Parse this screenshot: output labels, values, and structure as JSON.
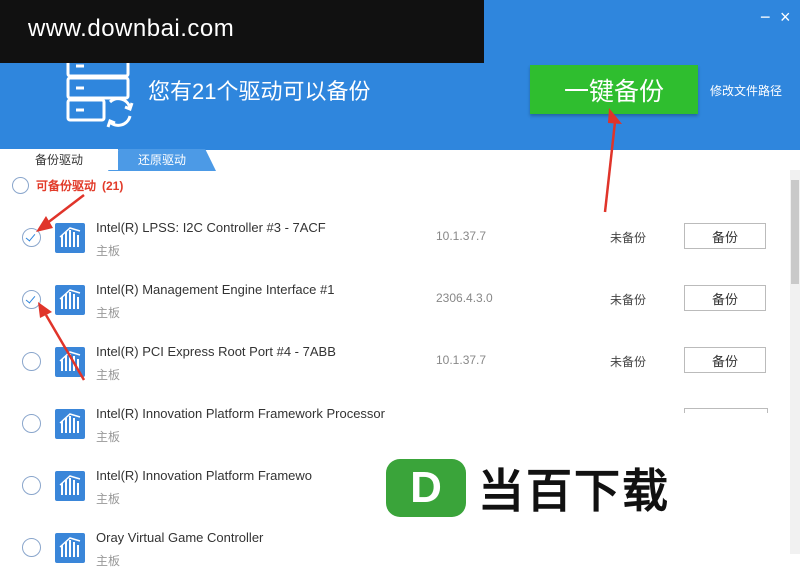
{
  "watermark": "www.downbai.com",
  "header": {
    "headline": "您有21个驱动可以备份",
    "backup_all_label": "一键备份",
    "change_path_label": "修改文件路径",
    "minimize_glyph": "−",
    "close_glyph": "×",
    "server_icon": "server-sync-icon"
  },
  "tabs": [
    {
      "label": "备份驱动",
      "active": true
    },
    {
      "label": "还原驱动",
      "active": false
    }
  ],
  "group": {
    "label": "可备份驱动",
    "count": "(21)"
  },
  "drivers": [
    {
      "name": "Intel(R) LPSS: I2C Controller #3 - 7ACF",
      "category": "主板",
      "version": "10.1.37.7",
      "status": "未备份",
      "action": "备份",
      "checked": true
    },
    {
      "name": "Intel(R) Management Engine Interface #1",
      "category": "主板",
      "version": "2306.4.3.0",
      "status": "未备份",
      "action": "备份",
      "checked": true
    },
    {
      "name": "Intel(R) PCI Express Root Port #4 - 7ABB",
      "category": "主板",
      "version": "10.1.37.7",
      "status": "未备份",
      "action": "备份",
      "checked": false
    },
    {
      "name": "Intel(R) Innovation Platform Framework Processor",
      "category": "主板",
      "version": "",
      "status": "",
      "action": "",
      "checked": false
    },
    {
      "name": "Intel(R) Innovation Platform Framewo",
      "category": "主板",
      "version": "",
      "status": "",
      "action": "",
      "checked": false
    },
    {
      "name": "Oray Virtual Game Controller",
      "category": "主板",
      "version": "",
      "status": "",
      "action": "",
      "checked": false
    }
  ],
  "brand": {
    "logo_letter": "D",
    "name": "当百下载"
  },
  "colors": {
    "header_blue": "#2f86dd",
    "button_green": "#2fbe2f",
    "arrow_red": "#e0342a",
    "group_red": "#e23b2a"
  }
}
